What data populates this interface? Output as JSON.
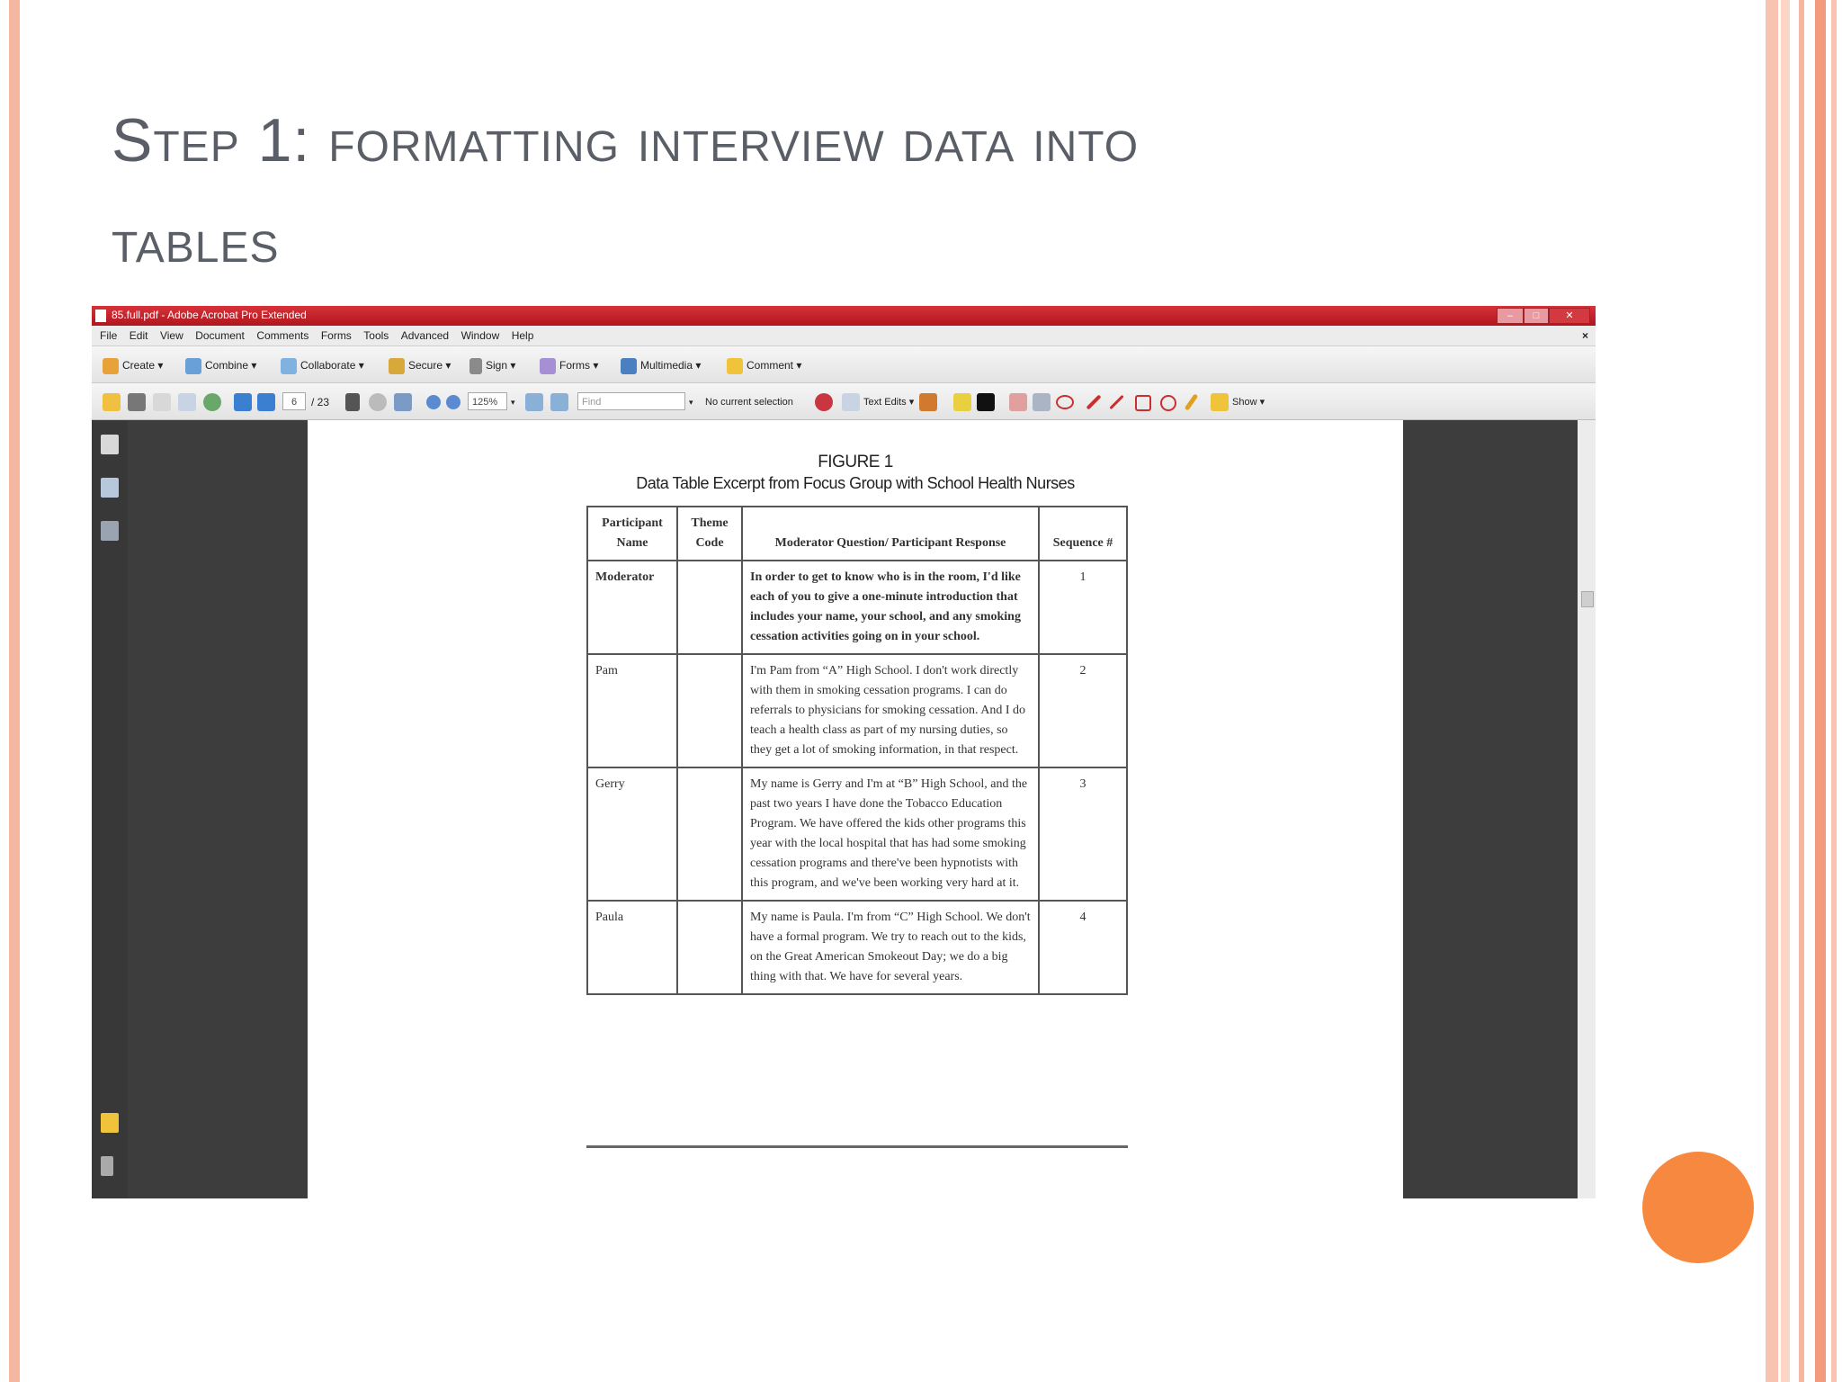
{
  "slide": {
    "title_line1": "Step 1: formatting interview data into",
    "title_line2": "tables"
  },
  "window": {
    "title": "85.full.pdf - Adobe Acrobat Pro Extended",
    "controls": [
      "–",
      "□",
      "✕"
    ]
  },
  "menu": [
    "File",
    "Edit",
    "View",
    "Document",
    "Comments",
    "Forms",
    "Tools",
    "Advanced",
    "Window",
    "Help"
  ],
  "toolbar1": {
    "create": "Create ▾",
    "combine": "Combine ▾",
    "collaborate": "Collaborate ▾",
    "secure": "Secure ▾",
    "sign": "Sign ▾",
    "forms": "Forms ▾",
    "multimedia": "Multimedia ▾",
    "comment": "Comment ▾"
  },
  "toolbar2": {
    "page_current": "6",
    "page_total": "/ 23",
    "zoom": "125%",
    "find_placeholder": "Find",
    "selection": "No current selection",
    "text_edits": "Text Edits ▾",
    "show": "Show ▾"
  },
  "document": {
    "figure_title": "FIGURE 1",
    "figure_subtitle": "Data Table Excerpt from Focus Group with School Health Nurses",
    "columns": {
      "c1": "Participant Name",
      "c2": "Theme Code",
      "c3": "Moderator Question/ Participant Response",
      "c4": "Sequence #"
    },
    "rows": [
      {
        "name": "Moderator",
        "code": "",
        "response": "In order to get to know who is in the room, I'd like each of you to give a one-minute introduction that includes your name, your school, and any smoking cessation activities going on in your school.",
        "seq": "1"
      },
      {
        "name": "Pam",
        "code": "",
        "response": "I'm Pam from “A” High School. I don't work directly with them in smoking cessation programs. I can do referrals to physicians for smoking cessation. And I do teach a health class as part of my nursing duties, so they get a lot of smoking information, in that respect.",
        "seq": "2"
      },
      {
        "name": "Gerry",
        "code": "",
        "response": "My name is Gerry and I'm at “B” High School, and the past two years I have done the Tobacco Education Program. We have offered the kids other programs this year with the local hospital that has had some smoking cessation programs and there've been hypnotists with this program, and we've been working very hard at it.",
        "seq": "3"
      },
      {
        "name": "Paula",
        "code": "",
        "response": "My name is Paula. I'm from “C” High School. We don't have a formal program. We try to reach out to the kids, on the Great American Smokeout Day; we do a big thing with that. We have for several years.",
        "seq": "4"
      }
    ]
  }
}
